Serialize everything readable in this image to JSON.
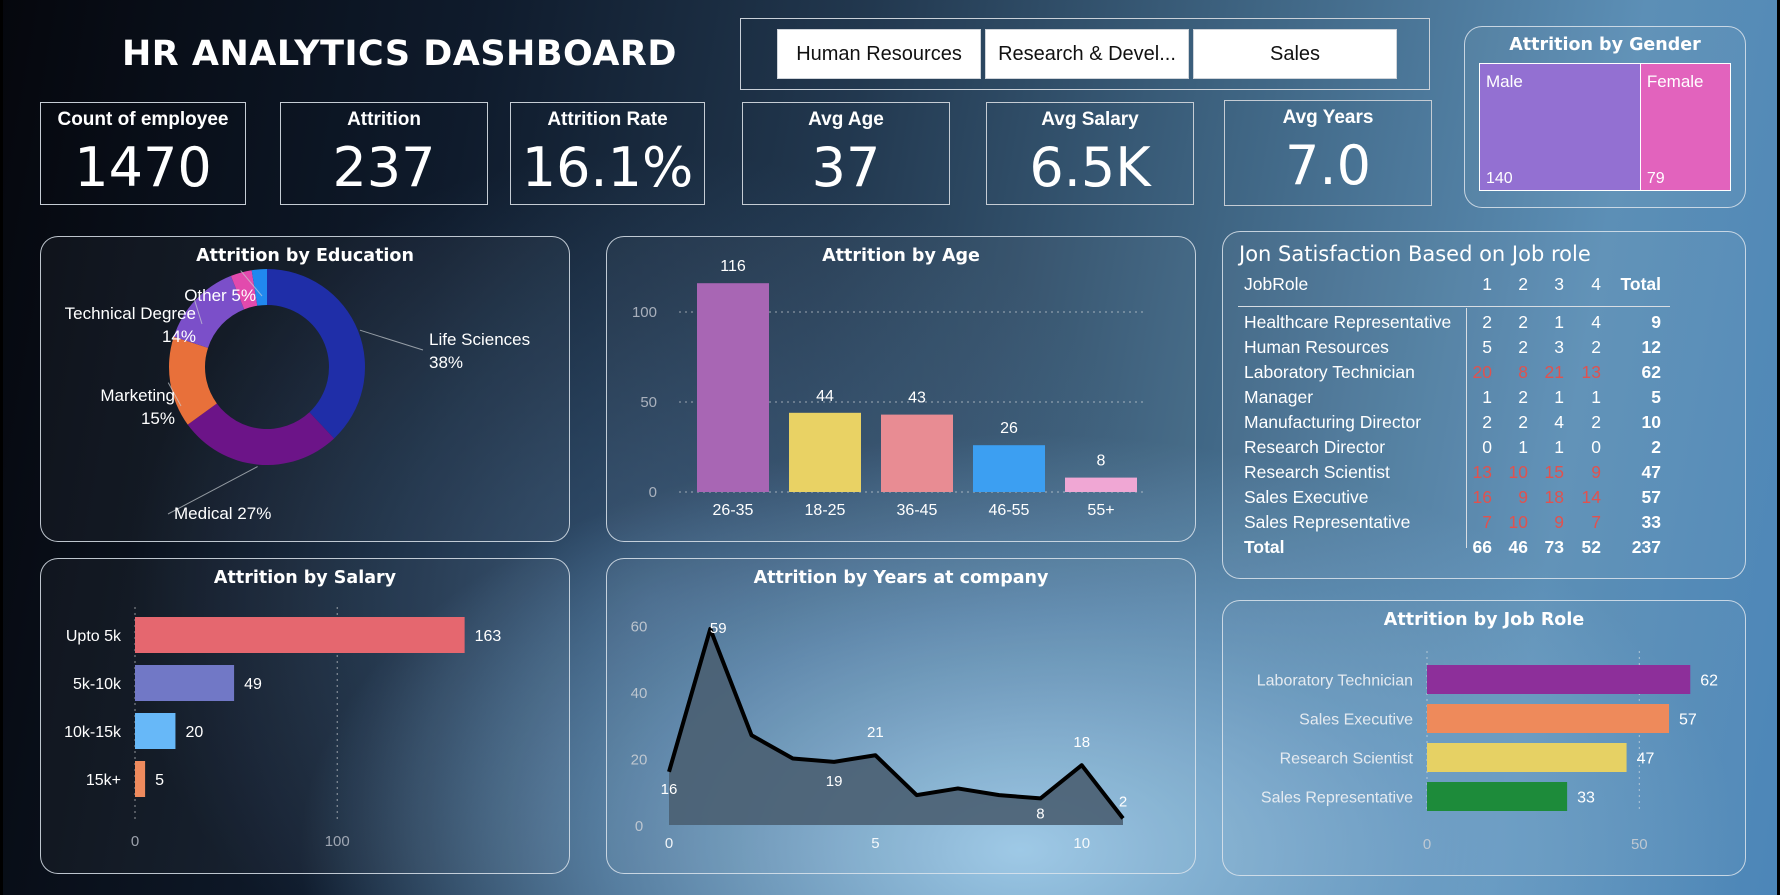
{
  "title": "HR ANALYTICS DASHBOARD",
  "slicer": {
    "options": [
      "Human Resources",
      "Research & Devel...",
      "Sales"
    ]
  },
  "kpis": [
    {
      "label": "Count of employee",
      "value": "1470"
    },
    {
      "label": "Attrition",
      "value": "237"
    },
    {
      "label": "Attrition Rate",
      "value": "16.1%"
    },
    {
      "label": "Avg Age",
      "value": "37"
    },
    {
      "label": "Avg Salary",
      "value": "6.5K"
    },
    {
      "label": "Avg Years",
      "value": "7.0"
    }
  ],
  "chart_data": [
    {
      "id": "gender",
      "type": "treemap",
      "title": "Attrition by Gender",
      "categories": [
        "Male",
        "Female"
      ],
      "values": [
        140,
        79
      ],
      "colors": [
        "#9370d2",
        "#e263bd"
      ]
    },
    {
      "id": "education",
      "type": "pie",
      "title": "Attrition by Education",
      "categories": [
        "Life Sciences",
        "Medical",
        "Marketing",
        "Technical Degree",
        "Other",
        ""
      ],
      "labels": [
        "Life Sciences",
        "Medical",
        "Marketing",
        "Technical Degree",
        "Other",
        ""
      ],
      "percents": [
        "38%",
        "27%",
        "15%",
        "14%",
        "5%",
        ""
      ],
      "values": [
        38,
        27,
        15,
        14,
        3.5,
        2.5
      ],
      "colors": [
        "#1f2ea8",
        "#6c1488",
        "#e8703a",
        "#7b4fc9",
        "#e24aad",
        "#2188ef"
      ]
    },
    {
      "id": "age",
      "type": "bar",
      "title": "Attrition by Age",
      "categories": [
        "26-35",
        "18-25",
        "36-45",
        "46-55",
        "55+"
      ],
      "values": [
        116,
        44,
        43,
        26,
        8
      ],
      "colors": [
        "#a866b4",
        "#e9d264",
        "#e88c93",
        "#3c9ff2",
        "#f0a7d4"
      ],
      "yticks": [
        0,
        50,
        100
      ],
      "ylim": [
        0,
        125
      ]
    },
    {
      "id": "salary",
      "type": "bar",
      "orientation": "horizontal",
      "title": "Attrition by Salary",
      "categories": [
        "Upto 5k",
        "5k-10k",
        "10k-15k",
        "15k+"
      ],
      "values": [
        163,
        49,
        20,
        5
      ],
      "colors": [
        "#e5676f",
        "#7178c6",
        "#67b8f8",
        "#ee8a5d"
      ],
      "xticks": [
        0,
        100
      ],
      "xlim": [
        0,
        180
      ]
    },
    {
      "id": "years",
      "type": "area",
      "title": "Attrition by Years at company",
      "x": [
        0,
        1,
        2,
        3,
        4,
        5,
        6,
        7,
        8,
        9,
        10,
        11
      ],
      "values": [
        16,
        59,
        27,
        20,
        19,
        21,
        9,
        11,
        9,
        8,
        18,
        2
      ],
      "data_labels": {
        "0": "16",
        "1": "59",
        "4": "19",
        "5": "21",
        "9": "8",
        "10": "18",
        "11": "2"
      },
      "xticks": [
        0,
        5,
        10
      ],
      "yticks": [
        0,
        20,
        40,
        60
      ],
      "ylim": [
        0,
        65
      ],
      "xlim": [
        0,
        11
      ],
      "fill": "#4a5f72",
      "line": "#000000"
    },
    {
      "id": "jobrole",
      "type": "bar",
      "orientation": "horizontal",
      "title": "Attrition by Job Role",
      "categories": [
        "Laboratory Technician",
        "Sales Executive",
        "Research Scientist",
        "Sales Representative"
      ],
      "values": [
        62,
        57,
        47,
        33
      ],
      "colors": [
        "#8d2f9a",
        "#ee8a5b",
        "#e6d164",
        "#1d8b3a"
      ],
      "xticks": [
        0,
        50
      ],
      "xlim": [
        0,
        65
      ]
    }
  ],
  "matrix": {
    "title": "Jon Satisfaction Based on Job role",
    "header": [
      "JobRole",
      "1",
      "2",
      "3",
      "4",
      "Total"
    ],
    "rows": [
      {
        "role": "Healthcare Representative",
        "v": [
          "2",
          "2",
          "1",
          "4"
        ],
        "total": "9",
        "hi": false
      },
      {
        "role": "Human Resources",
        "v": [
          "5",
          "2",
          "3",
          "2"
        ],
        "total": "12",
        "hi": false
      },
      {
        "role": "Laboratory Technician",
        "v": [
          "20",
          "8",
          "21",
          "13"
        ],
        "total": "62",
        "hi": true
      },
      {
        "role": "Manager",
        "v": [
          "1",
          "2",
          "1",
          "1"
        ],
        "total": "5",
        "hi": false
      },
      {
        "role": "Manufacturing Director",
        "v": [
          "2",
          "2",
          "4",
          "2"
        ],
        "total": "10",
        "hi": false
      },
      {
        "role": "Research Director",
        "v": [
          "0",
          "1",
          "1",
          "0"
        ],
        "total": "2",
        "hi": false
      },
      {
        "role": "Research Scientist",
        "v": [
          "13",
          "10",
          "15",
          "9"
        ],
        "total": "47",
        "hi": true
      },
      {
        "role": "Sales Executive",
        "v": [
          "16",
          "9",
          "18",
          "14"
        ],
        "total": "57",
        "hi": true
      },
      {
        "role": "Sales Representative",
        "v": [
          "7",
          "10",
          "9",
          "7"
        ],
        "total": "33",
        "hi": true
      }
    ],
    "total": {
      "label": "Total",
      "v": [
        "66",
        "46",
        "73",
        "52"
      ],
      "total": "237"
    },
    "highlight_color": "#e0524f"
  }
}
